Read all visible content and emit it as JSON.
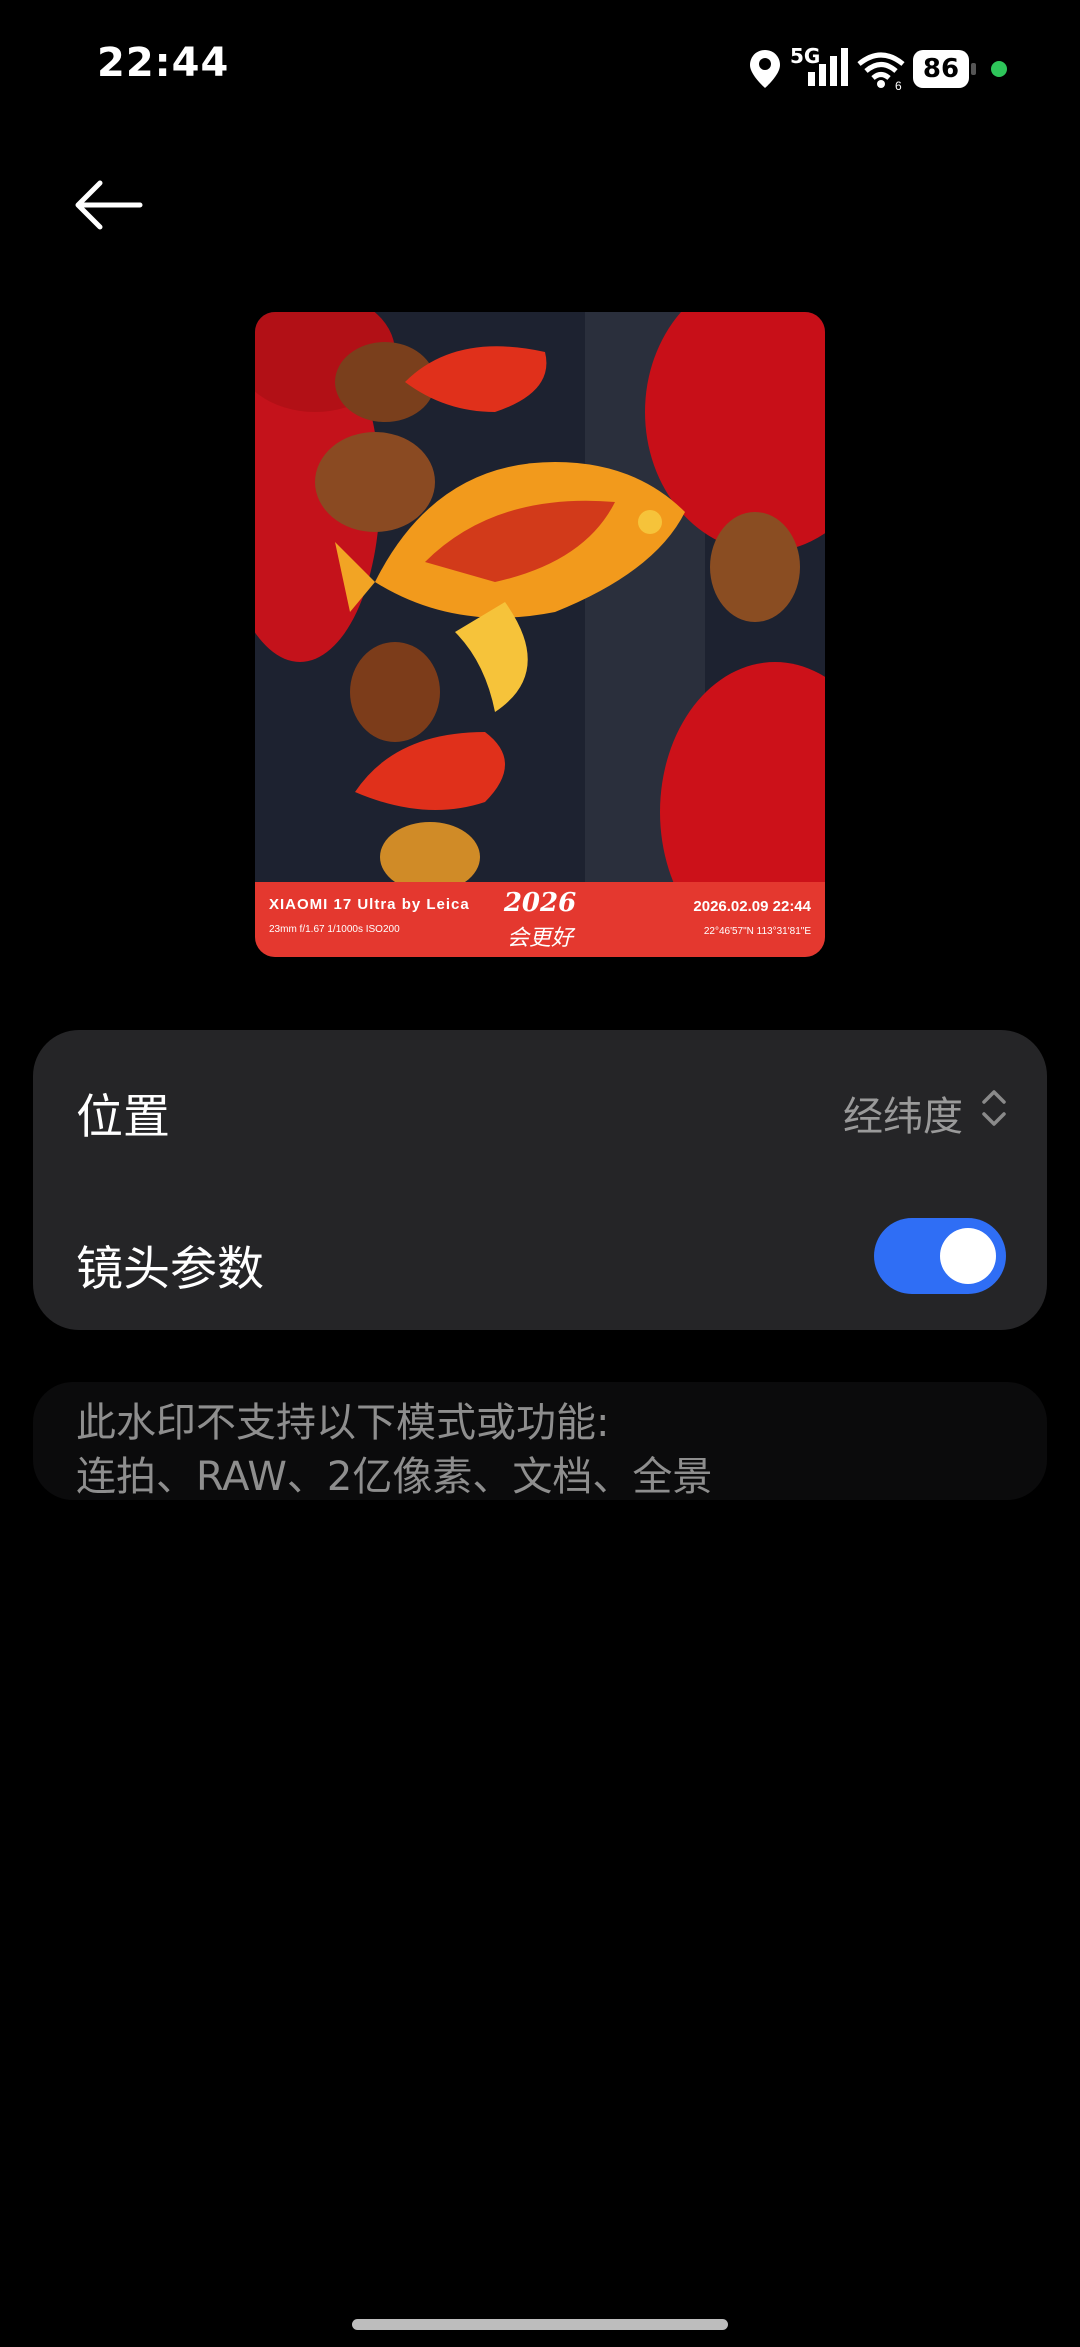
{
  "status_bar": {
    "time": "22:44",
    "network": "5G",
    "battery": "86",
    "icons": [
      "location-icon",
      "cellular-signal-icon",
      "wifi-icon",
      "battery-icon",
      "privacy-dot-icon"
    ]
  },
  "nav": {
    "back_icon": "arrow-left-icon"
  },
  "preview": {
    "brand": "XIAOMI 17 Ultra by Leica",
    "params": "23mm  f/1.67  1/1000s  ISO200",
    "slogan_year": "2026",
    "slogan": "会更好",
    "date": "2026.02.09 22:44",
    "coords": "22°46'57\"N  113°31'81\"E"
  },
  "settings": {
    "location_label": "位置",
    "location_value": "经纬度",
    "lens_label": "镜头参数",
    "lens_enabled": true
  },
  "notice": {
    "line1": "此水印不支持以下模式或功能:",
    "line2": "连拍、RAW、2亿像素、文档、全景"
  },
  "colors": {
    "background": "#000000",
    "card": "#252527",
    "toggle_on": "#2f6ef5",
    "watermark_red": "#e4382f"
  }
}
